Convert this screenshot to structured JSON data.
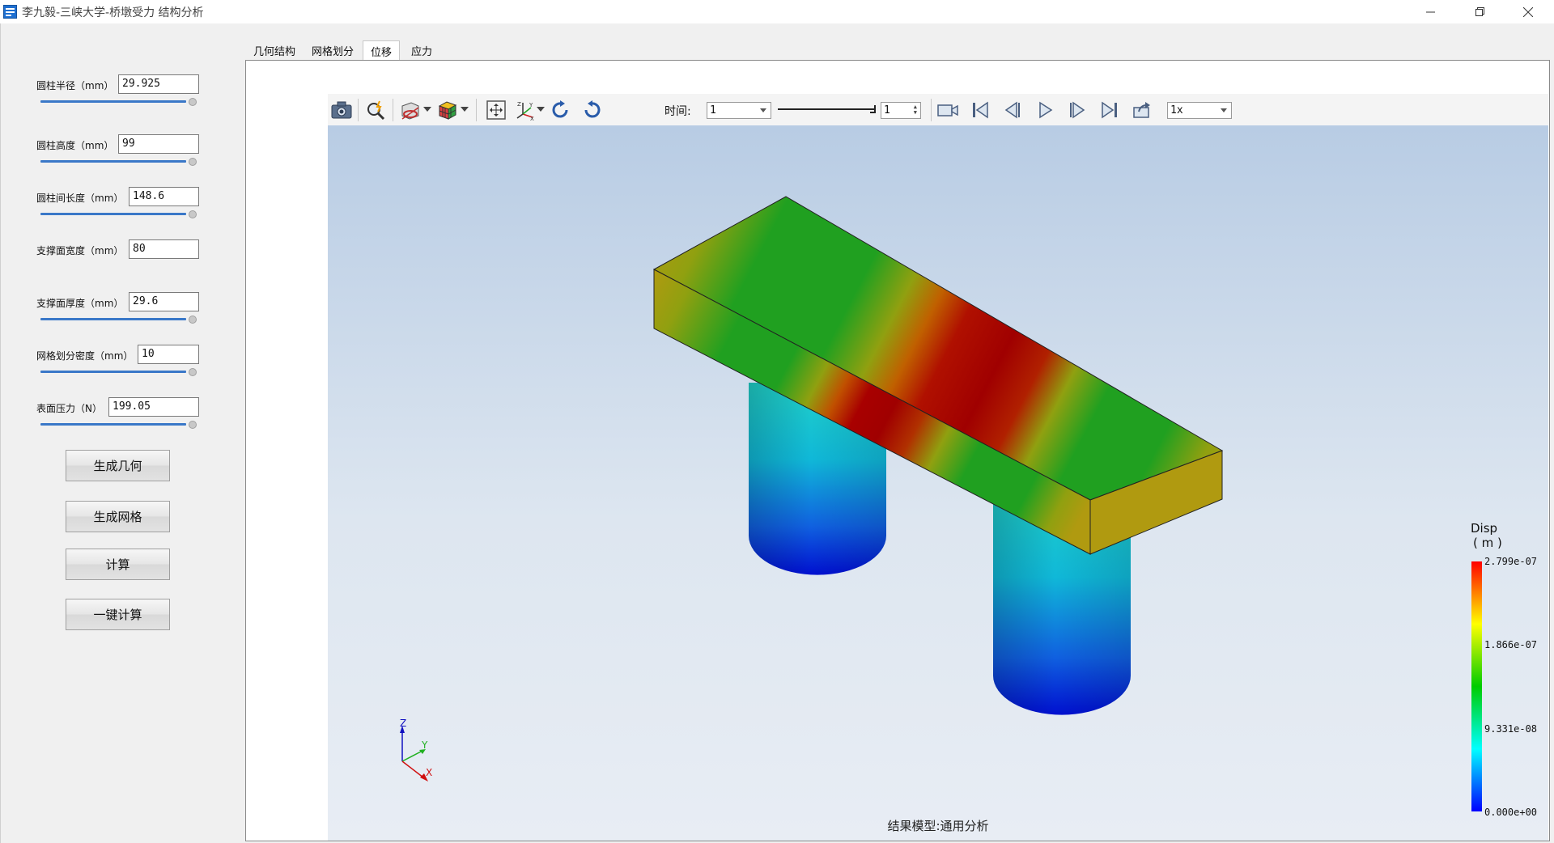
{
  "window": {
    "title": "李九毅-三峡大学-桥墩受力 结构分析"
  },
  "params": [
    {
      "label": "圆柱半径（mm）",
      "value": "29.925"
    },
    {
      "label": "圆柱高度（mm）",
      "value": "99"
    },
    {
      "label": "圆柱间长度（mm）",
      "value": "148.6"
    },
    {
      "label": "支撑面宽度（mm）",
      "value": "80"
    },
    {
      "label": "支撑面厚度（mm）",
      "value": "29.6"
    },
    {
      "label": "网格划分密度（mm）",
      "value": "10"
    },
    {
      "label": "表面压力（N）",
      "value": "199.05"
    }
  ],
  "buttons": {
    "generate_geometry": "生成几何",
    "generate_mesh": "生成网格",
    "compute": "计算",
    "one_click_compute": "一键计算"
  },
  "tabs": [
    "几何结构",
    "网格划分",
    "位移",
    "应力"
  ],
  "active_tab": "位移",
  "toolbar": {
    "time_label": "时间:",
    "time_value": "1",
    "frame_value": "1",
    "speed_value": "1x",
    "icons": [
      "camera-icon",
      "probe-icon",
      "clip-plane-icon",
      "color-map-icon",
      "fit-view-icon",
      "axes-icon",
      "rotate-cw-icon",
      "rotate-ccw-icon",
      "record-video-icon",
      "first-frame-icon",
      "prev-frame-icon",
      "play-icon",
      "next-frame-icon",
      "last-frame-icon",
      "export-icon"
    ]
  },
  "viewport": {
    "caption": "结果模型:通用分析",
    "axes": {
      "z": "Z",
      "y": "Y",
      "x": "X"
    }
  },
  "colorbar": {
    "title": "Disp",
    "unit": "( m )",
    "ticks": [
      "2.799e-07",
      "1.866e-07",
      "9.331e-08",
      "0.000e+00"
    ],
    "colors": [
      "#ff0000",
      "#ffff00",
      "#00cc00",
      "#00ffff",
      "#0000ff"
    ]
  }
}
